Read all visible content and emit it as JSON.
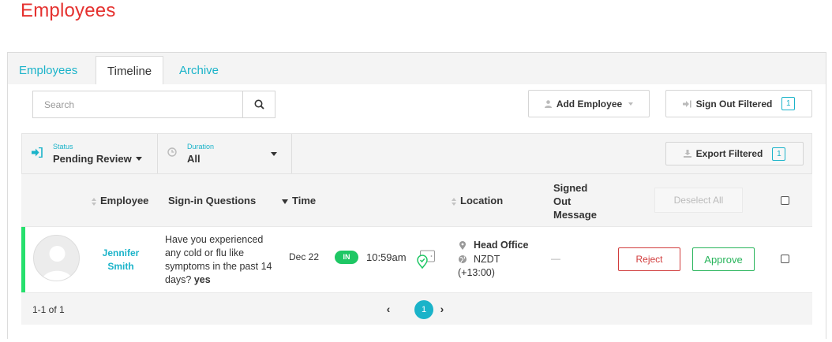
{
  "page": {
    "title": "Employees"
  },
  "tabs": [
    {
      "label": "Employees",
      "active": false
    },
    {
      "label": "Timeline",
      "active": true
    },
    {
      "label": "Archive",
      "active": false
    }
  ],
  "toolbar": {
    "search_placeholder": "Search",
    "add_employee_label": "Add Employee",
    "sign_out_label": "Sign Out Filtered",
    "sign_out_count": "1",
    "export_label": "Export Filtered",
    "export_count": "1"
  },
  "filters": {
    "status": {
      "label": "Status",
      "value": "Pending Review"
    },
    "duration": {
      "label": "Duration",
      "value": "All"
    }
  },
  "table": {
    "headers": {
      "employee": "Employee",
      "questions": "Sign-in Questions",
      "time": "Time",
      "location": "Location",
      "signed_out_message": [
        "Signed",
        "Out",
        "Message"
      ]
    },
    "deselect_all_label": "Deselect All",
    "rows": [
      {
        "name": [
          "Jennifer",
          "Smith"
        ],
        "question": "Have you experienced any cold or flu like symptoms in the past 14 days?",
        "answer": "yes",
        "date": "Dec 22",
        "direction": "IN",
        "time": "10:59am",
        "location_name": "Head Office",
        "timezone": "NZDT",
        "offset": "(+13:00)",
        "signed_out_message": "—",
        "reject_label": "Reject",
        "approve_label": "Approve"
      }
    ]
  },
  "pagination": {
    "info": "1-1 of 1",
    "current": "1",
    "prev": "‹",
    "next": "›"
  },
  "colors": {
    "accent": "#1ab3c9",
    "title": "#e5312f",
    "success": "#1ec764",
    "danger": "#d13c3c"
  }
}
